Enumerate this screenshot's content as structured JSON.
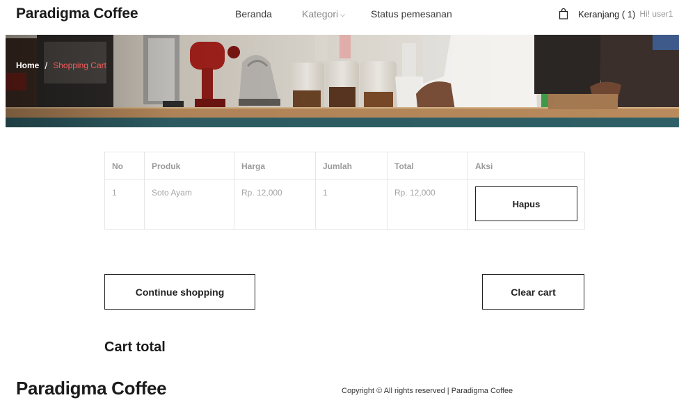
{
  "header": {
    "brand": "Paradigma Coffee",
    "nav": {
      "beranda": "Beranda",
      "kategori": "Kategori",
      "status": "Status pemesanan"
    },
    "cart": {
      "label": "Keranjang ( 1)",
      "greeting": "Hi! user1"
    }
  },
  "banner": {
    "breadcrumb": {
      "home": "Home",
      "separator": "/",
      "current": "Shopping Cart"
    }
  },
  "table": {
    "headers": [
      "No",
      "Produk",
      "Harga",
      "Jumlah",
      "Total",
      "Aksi"
    ],
    "rows": [
      {
        "no": "1",
        "produk": "Soto Ayam",
        "harga": "Rp. 12,000",
        "jumlah": "1",
        "total": "Rp. 12,000",
        "aksi": "Hapus"
      }
    ]
  },
  "actions": {
    "continue": "Continue shopping",
    "clear": "Clear cart"
  },
  "cart_total": {
    "title": "Cart total"
  },
  "footer": {
    "brand": "Paradigma Coffee",
    "copyright": "Copyright © All rights reserved | Paradigma Coffee"
  },
  "colors": {
    "breadcrumb_current": "#f25b5b",
    "muted_text": "#a5a5a5",
    "border": "#e6e6e6"
  },
  "icons": {
    "cart": "shopping-bag-icon",
    "kategori_dropdown": "chevron-down-icon"
  }
}
